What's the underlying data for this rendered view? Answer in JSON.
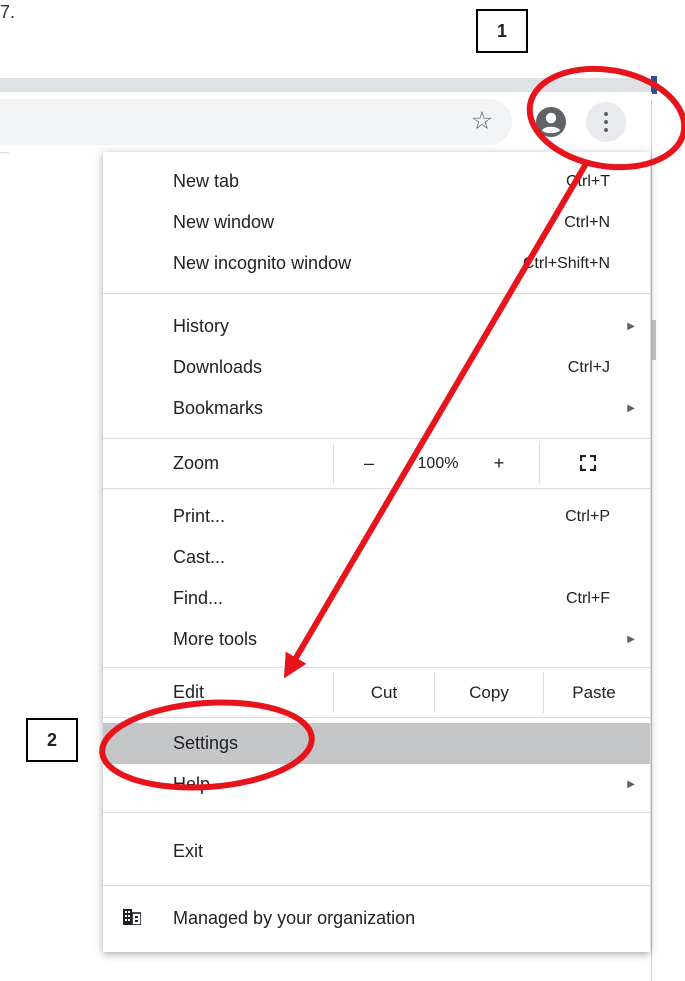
{
  "corner_text": "7.",
  "annotations": {
    "step1": "1",
    "step2": "2"
  },
  "toolbar": {
    "bookmark_icon": "star-outline-icon",
    "profile_icon": "account-circle-icon",
    "menu_icon": "more-vertical-icon"
  },
  "menu": {
    "new_tab": {
      "label": "New tab",
      "shortcut": "Ctrl+T"
    },
    "new_window": {
      "label": "New window",
      "shortcut": "Ctrl+N"
    },
    "new_incognito": {
      "label": "New incognito window",
      "shortcut": "Ctrl+Shift+N"
    },
    "history": {
      "label": "History"
    },
    "downloads": {
      "label": "Downloads",
      "shortcut": "Ctrl+J"
    },
    "bookmarks": {
      "label": "Bookmarks"
    },
    "zoom": {
      "label": "Zoom",
      "minus": "–",
      "level": "100%",
      "plus": "+"
    },
    "print": {
      "label": "Print...",
      "shortcut": "Ctrl+P"
    },
    "cast": {
      "label": "Cast..."
    },
    "find": {
      "label": "Find...",
      "shortcut": "Ctrl+F"
    },
    "more_tools": {
      "label": "More tools"
    },
    "edit": {
      "label": "Edit",
      "cut": "Cut",
      "copy": "Copy",
      "paste": "Paste"
    },
    "settings": {
      "label": "Settings"
    },
    "help": {
      "label": "Help"
    },
    "exit": {
      "label": "Exit"
    },
    "managed": {
      "label": "Managed by your organization",
      "icon": "building-icon"
    },
    "submenu_arrow": "▶"
  },
  "colors": {
    "annotation_red": "#e8141b",
    "menu_highlight": "#c5c6c8",
    "icon_gray": "#5f6368"
  }
}
